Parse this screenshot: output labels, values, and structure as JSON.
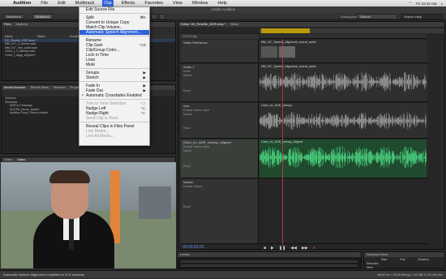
{
  "menubar": {
    "apple": "",
    "app": "Audition",
    "items": [
      "File",
      "Edit",
      "Multitrack",
      "Clip",
      "Effects",
      "Favorites",
      "View",
      "Window",
      "Help"
    ],
    "active": "Clip",
    "right_time": "Fri 10:43 AM",
    "right_user": "Adobe"
  },
  "window_title": "Adobe Audition",
  "toolbar": {
    "waveform": "Waveform",
    "multitrack": "Multitrack",
    "workspace_label": "Workspace:",
    "workspace_value": "Default",
    "search_placeholder": "Search Help"
  },
  "clip_menu": [
    {
      "label": "Edit Source File",
      "type": "item"
    },
    {
      "type": "sep"
    },
    {
      "label": "Split",
      "shortcut": "⌘K",
      "type": "item"
    },
    {
      "label": "Convert to Unique Copy",
      "type": "item"
    },
    {
      "label": "Match Clip Volume...",
      "type": "item"
    },
    {
      "label": "Automatic Speech Alignment...",
      "type": "item",
      "highlight": true
    },
    {
      "type": "sep"
    },
    {
      "label": "Rename",
      "type": "item"
    },
    {
      "label": "Clip Gain",
      "shortcut": "⌥G",
      "type": "item"
    },
    {
      "label": "Clip/Group Color...",
      "type": "item"
    },
    {
      "label": "Lock in Time",
      "type": "item"
    },
    {
      "label": "Loop",
      "type": "item"
    },
    {
      "label": "Mute",
      "type": "item"
    },
    {
      "type": "sep"
    },
    {
      "label": "Groups",
      "shortcut": "▶",
      "type": "item"
    },
    {
      "label": "Stretch",
      "shortcut": "▶",
      "type": "item"
    },
    {
      "type": "sep"
    },
    {
      "label": "Fade In",
      "shortcut": "▶",
      "type": "item"
    },
    {
      "label": "Fade Out",
      "shortcut": "▶",
      "type": "item"
    },
    {
      "label": "Automatic Crossfades Enabled",
      "type": "item",
      "check": "✓"
    },
    {
      "type": "sep"
    },
    {
      "label": "Trim to Time Selection",
      "shortcut": "⌥T",
      "type": "item",
      "disabled": true
    },
    {
      "label": "Nudge Left",
      "shortcut": "⌥,",
      "type": "item"
    },
    {
      "label": "Nudge Right",
      "shortcut": "⌥.",
      "type": "item"
    },
    {
      "label": "Send Clip to Back",
      "type": "item",
      "disabled": true
    },
    {
      "type": "sep"
    },
    {
      "label": "Reveal Clips in Files Panel",
      "type": "item"
    },
    {
      "label": "Link Media...",
      "type": "item",
      "disabled": true
    },
    {
      "label": "Link All Media...",
      "type": "item",
      "disabled": true
    }
  ],
  "files_panel": {
    "tab": "Files",
    "tab2": "Markers",
    "columns": [
      "Name",
      "Status",
      "Duration"
    ],
    "rows": [
      "DS_Rewrite_ADR.sesx *",
      "MM_017_1_source.wav",
      "MM_017_rew_audio.wav",
      "Outro_f_1_Meetup.wav",
      "Outro_f_asgp_Aligned *"
    ]
  },
  "media_panel": {
    "tabs": [
      "Media Browser",
      "Effects Rack",
      "Markers",
      "Properties"
    ],
    "rows": [
      "Volumes",
      "Shortcuts",
      "ADR in Freeways",
      "AUCS6_Demo_Assets",
      "Audition Drop 2 Demo Assets"
    ]
  },
  "video_panel": {
    "tabs": [
      "Video",
      "Video"
    ]
  },
  "editor": {
    "tab": "Editor: 06_Rewrite_ADR.sesx *",
    "mixer": "Mixer",
    "rate": "23.976 fps"
  },
  "tracks": [
    {
      "name": "Video Reference",
      "clip": "MM_017_Speech_Alignment_source_audio"
    },
    {
      "name": "Audio 1",
      "clip": "MM_017_Speech_Alignment_source_audio",
      "ctl1": "None",
      "ctl2": "Master",
      "ctl3": "Read"
    },
    {
      "name": "new",
      "clip": "Outro_for_ADR_meetup",
      "ctl1": "Default Stereo Input",
      "ctl2": "Master",
      "ctl3": "Read"
    },
    {
      "name": "Outro_for_ADR_meetup_Aligned",
      "clip": "Outro_for_ADR_meetup_Aligned",
      "ctl1": "Default Stereo Input",
      "ctl2": "Master",
      "ctl3": "Read"
    },
    {
      "name": "Master",
      "ctl1": "Default Output",
      "ctl2": "Read"
    }
  ],
  "transport_time": "00:00:03.00",
  "levels_label": "Levels",
  "selection": {
    "title": "Selection/View",
    "start_label": "Start",
    "end_label": "End",
    "dur_label": "Duration",
    "sel": "Selection",
    "view": "View"
  },
  "status": {
    "left": "Automatic Speech Alignment completed in 3.02 seconds",
    "right": "48000 Hz • 32-bit Mixing     7.62 MB     13.30 GB free"
  }
}
